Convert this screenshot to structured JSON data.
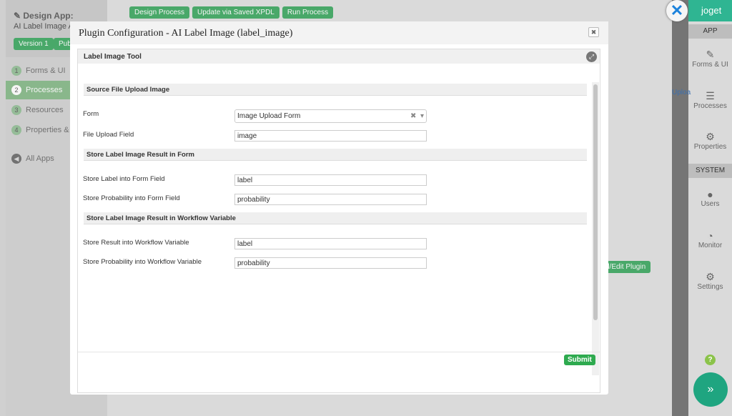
{
  "left": {
    "title": "Design App:",
    "app_name": "AI Label Image A",
    "version": "Version 1",
    "publish": "Publi",
    "steps": [
      {
        "n": "1",
        "label": "Forms & UI"
      },
      {
        "n": "2",
        "label": "Processes"
      },
      {
        "n": "3",
        "label": "Resources"
      },
      {
        "n": "4",
        "label": "Properties & E"
      }
    ],
    "all_apps": "All Apps"
  },
  "toolbar": {
    "design": "Design Process",
    "update": "Update via Saved XPDL",
    "run": "Run Process"
  },
  "bg": {
    "edit_plugin": "d/Edit Plugin",
    "upload": "Uploa"
  },
  "rail": {
    "logo": "joget",
    "app": "APP",
    "forms": "Forms & UI",
    "processes": "Processes",
    "properties": "Properties",
    "system": "SYSTEM",
    "users": "Users",
    "monitor": "Monitor",
    "settings": "Settings",
    "help": "?",
    "expand": "»"
  },
  "modal": {
    "title": "Plugin Configuration - AI Label Image (label_image)",
    "panel_title": "Label Image Tool",
    "sections": [
      "Source File Upload Image",
      "Store Label Image Result in Form",
      "Store Label Image Result in Workflow Variable"
    ],
    "fields": [
      {
        "label": "Form",
        "value": "Image Upload Form"
      },
      {
        "label": "File Upload Field",
        "value": "image"
      },
      {
        "label": "Store Label into Form Field",
        "value": "label"
      },
      {
        "label": "Store Probability into Form Field",
        "value": "probability"
      },
      {
        "label": "Store Result into Workflow Variable",
        "value": "label"
      },
      {
        "label": "Store Probability into Workflow Variable",
        "value": "probability"
      }
    ],
    "submit": "Submit"
  }
}
